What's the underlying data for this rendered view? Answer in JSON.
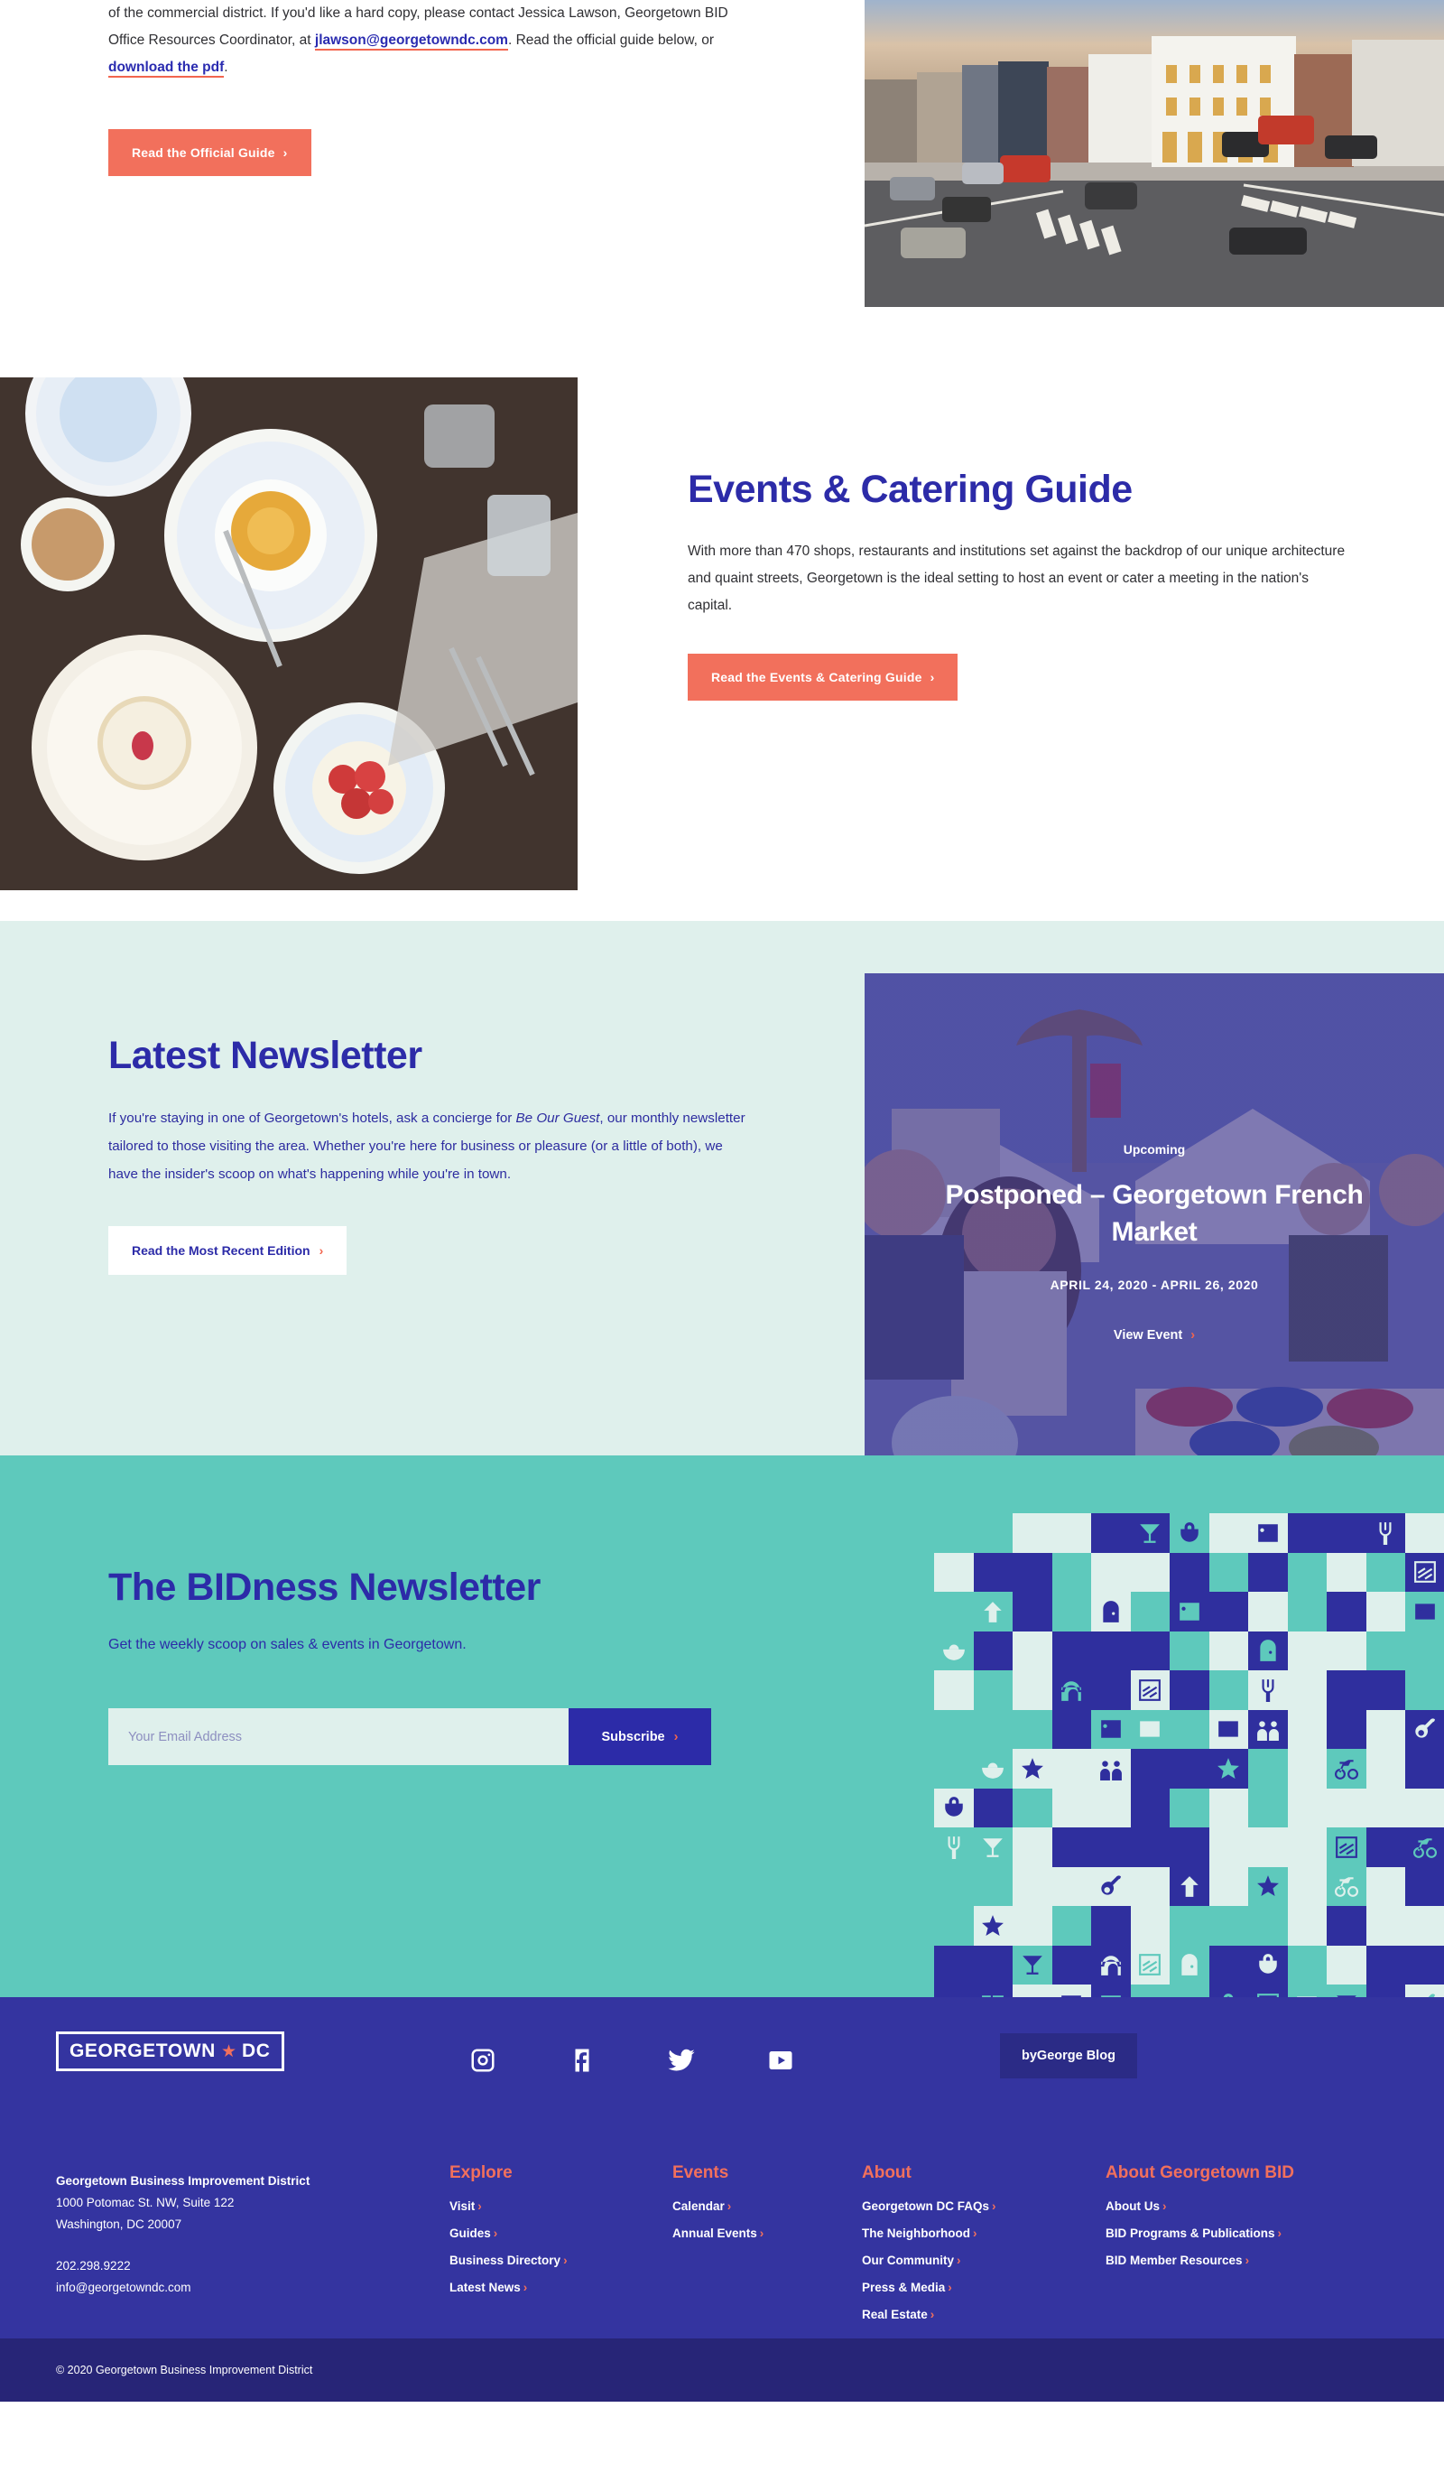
{
  "colors": {
    "coral": "#f2705c",
    "blue": "#2c2ba8",
    "deep_blue": "#3434a0",
    "teal": "#5ec9bc",
    "mint": "#dff0ec",
    "footer_bottom": "#272577"
  },
  "intro": {
    "paragraph_part1": "of the commercial district. If you'd like a hard copy, please contact Jessica Lawson, Georgetown BID Office Resources Coordinator, at ",
    "email_link": "jlawson@georgetowndc.com",
    "paragraph_part2": ". Read the official guide below, or ",
    "pdf_link": "download the pdf",
    "paragraph_part3": ".",
    "button_label": "Read the Official Guide",
    "chevron": "›"
  },
  "events_section": {
    "heading": "Events & Catering Guide",
    "body": "With more than 470 shops, restaurants and institutions set against the backdrop of our unique architecture and quaint streets, Georgetown is the ideal setting to host an event or cater a meeting in the nation's capital.",
    "button_label": "Read the Events & Catering Guide",
    "chevron": "›"
  },
  "newsletter_section": {
    "heading": "Latest Newsletter",
    "body_part1": "If you're staying in one of Georgetown's hotels, ask a concierge for ",
    "body_italic": "Be Our Guest",
    "body_part2": ", our monthly newsletter tailored to those visiting the area. Whether you're here for business or pleasure (or a little of both), we have the insider's scoop on what's happening while you're in town.",
    "button_label": "Read the Most Recent Edition",
    "chevron": "›"
  },
  "event_card": {
    "badge": "Upcoming",
    "title": "Postponed – Georgetown French Market",
    "date_range": "APRIL 24, 2020 - APRIL 26, 2020",
    "link_label": "View Event",
    "chevron": "›"
  },
  "bidness_section": {
    "heading": "The BIDness Newsletter",
    "subheading": "Get the weekly scoop on sales & events in Georgetown.",
    "email_placeholder": "Your Email Address",
    "email_value": "",
    "subscribe_label": "Subscribe",
    "chevron": "›"
  },
  "footer": {
    "logo_text_left": "GEORGETOWN",
    "logo_star": "★",
    "logo_text_right": "DC",
    "socials": [
      "instagram-icon",
      "facebook-icon",
      "twitter-icon",
      "youtube-icon"
    ],
    "blog_button": "byGeorge Blog",
    "org_name": "Georgetown Business Improvement District",
    "address_line1": "1000 Potomac St. NW, Suite 122",
    "address_line2": "Washington, DC 20007",
    "phone": "202.298.9222",
    "email": "info@georgetowndc.com",
    "columns": [
      {
        "title": "Explore",
        "links": [
          "Visit",
          "Guides",
          "Business Directory",
          "Latest News"
        ]
      },
      {
        "title": "Events",
        "links": [
          "Calendar",
          "Annual Events"
        ]
      },
      {
        "title": "About",
        "links": [
          "Georgetown DC FAQs",
          "The Neighborhood",
          "Our Community",
          "Press & Media",
          "Real Estate"
        ]
      },
      {
        "title": "About Georgetown BID",
        "links": [
          "About Us",
          "BID Programs & Publications",
          "BID Member Resources"
        ]
      }
    ],
    "chevron": "›",
    "copyright": "© 2020 Georgetown Business Improvement District"
  },
  "mosaic": {
    "icon_names": [
      "people-icon",
      "basket-icon",
      "guitar-icon",
      "star-icon",
      "bicycle-icon",
      "bridge-icon",
      "brick-icon",
      "door-icon",
      "stairs-icon",
      "landscape-icon",
      "fork-icon",
      "arrow-up-icon",
      "bowl-icon",
      "picture-icon",
      "martini-icon"
    ]
  }
}
